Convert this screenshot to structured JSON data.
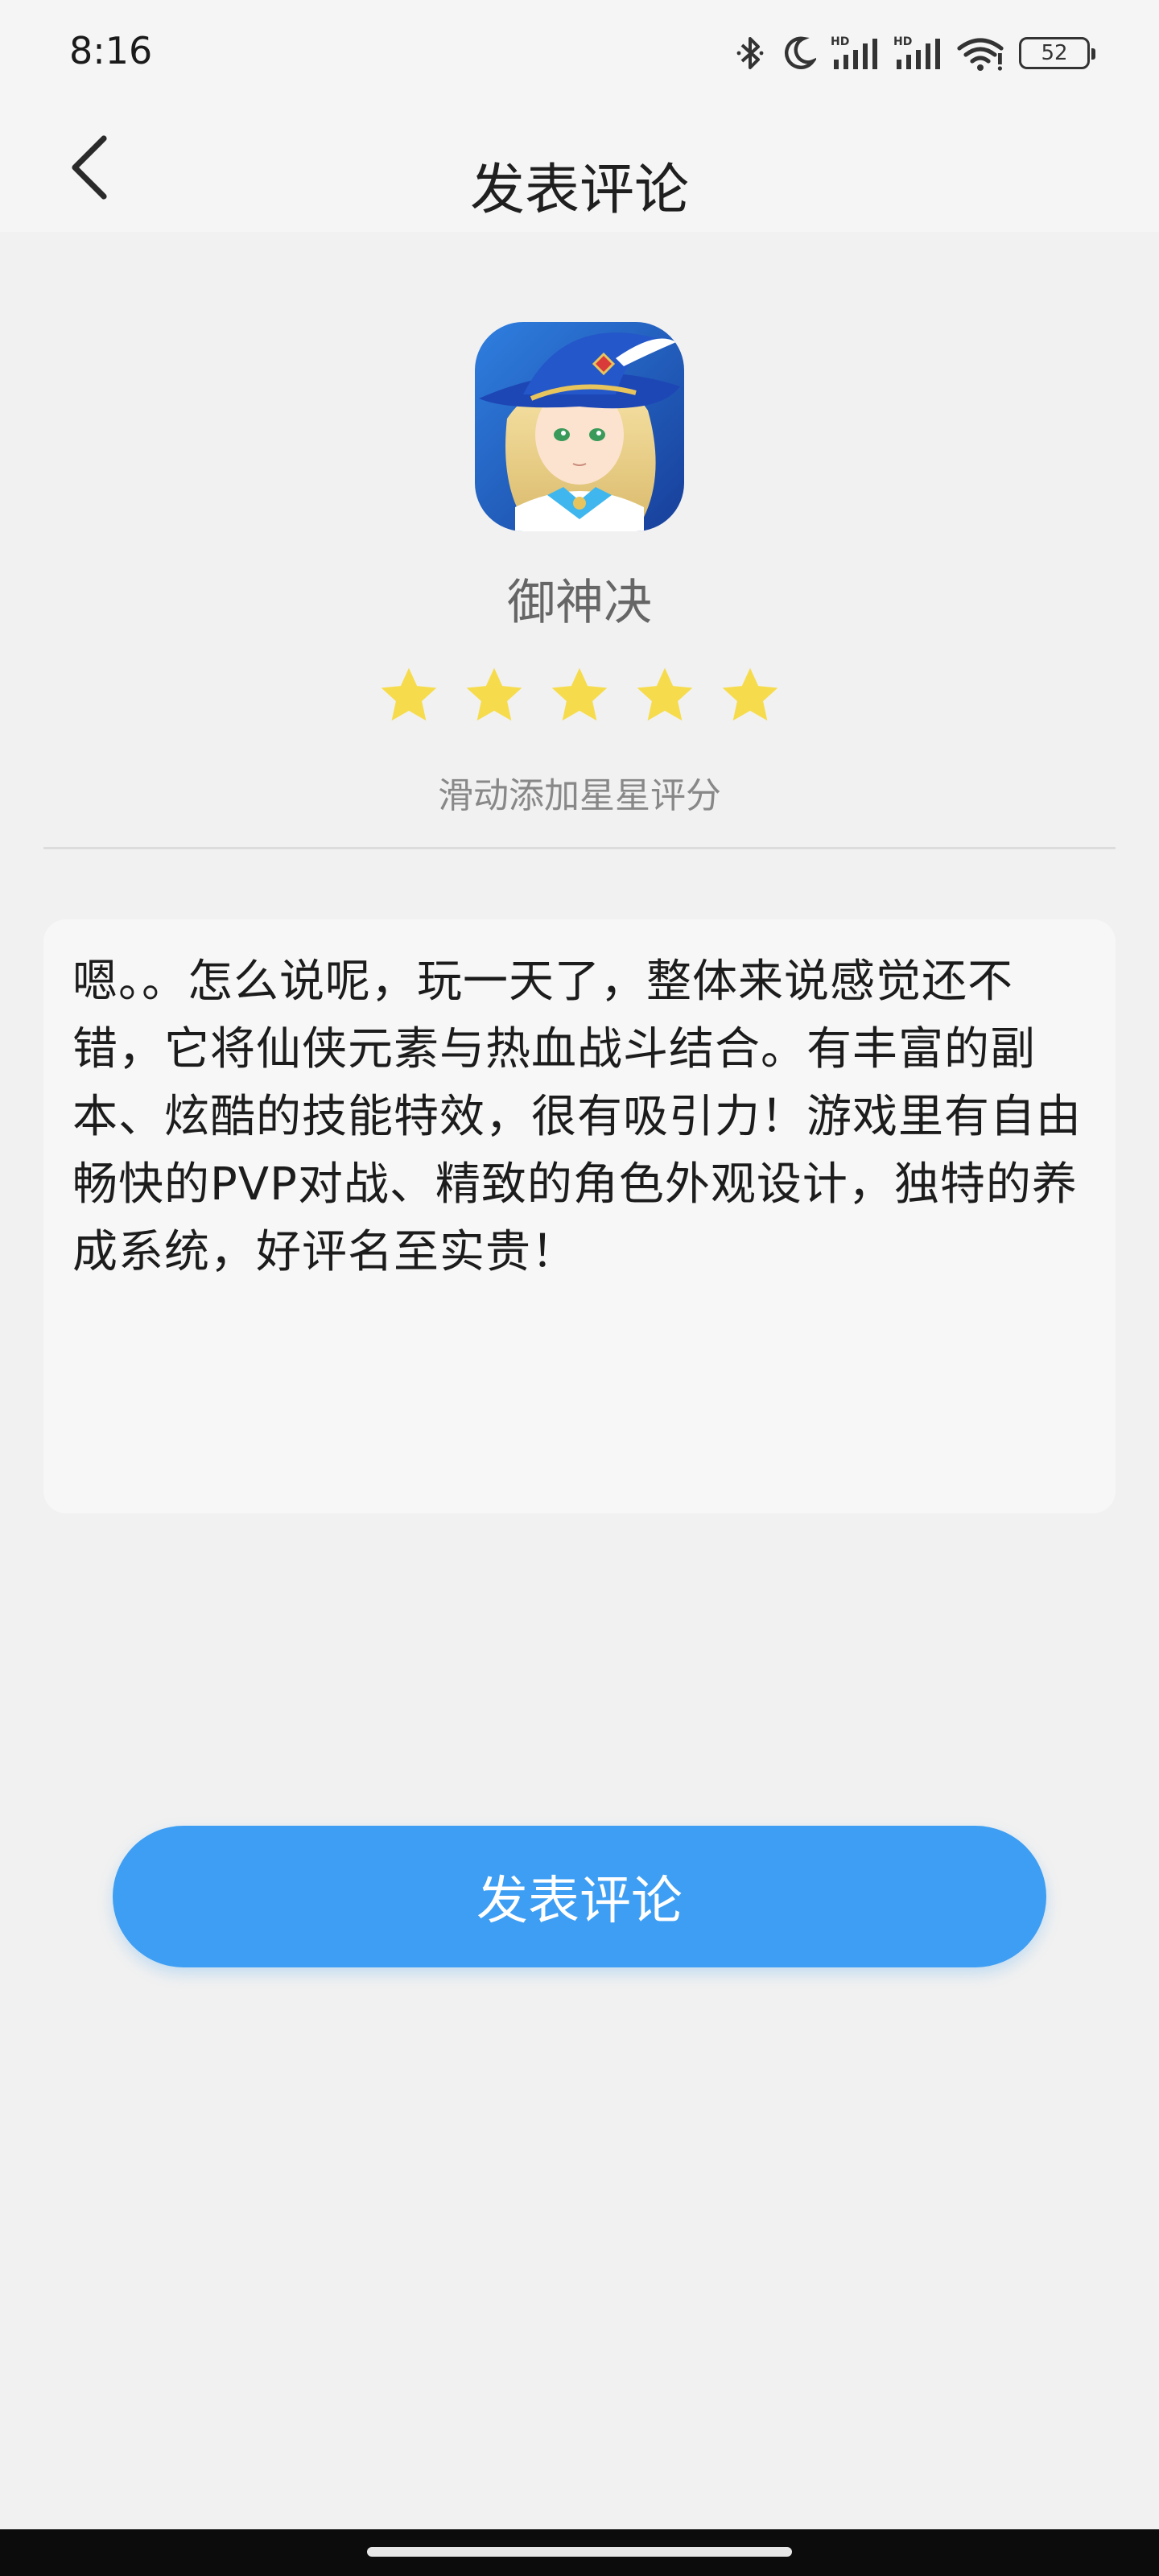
{
  "status_bar": {
    "time": "8:16",
    "battery": "52",
    "icons": [
      "bluetooth-icon",
      "moon-icon",
      "signal-hd-icon",
      "signal-hd-icon",
      "wifi-icon",
      "battery-icon"
    ]
  },
  "nav": {
    "title": "发表评论",
    "back_icon": "chevron-left-icon"
  },
  "app": {
    "name": "御神决",
    "icon": "app-icon-game-character"
  },
  "rating": {
    "stars": 5,
    "max": 5,
    "star_color": "#f6dc4c",
    "hint": "滑动添加星星评分"
  },
  "comment": {
    "text": "嗯。。怎么说呢，玩一天了，整体来说感觉还不错，它将仙侠元素与热血战斗结合。有丰富的副本、炫酷的技能特效，很有吸引力！游戏里有自由畅快的PVP对战、精致的角色外观设计，独特的养成系统，好评名至实贵！"
  },
  "submit": {
    "label": "发表评论",
    "color": "#3d9ef3"
  }
}
